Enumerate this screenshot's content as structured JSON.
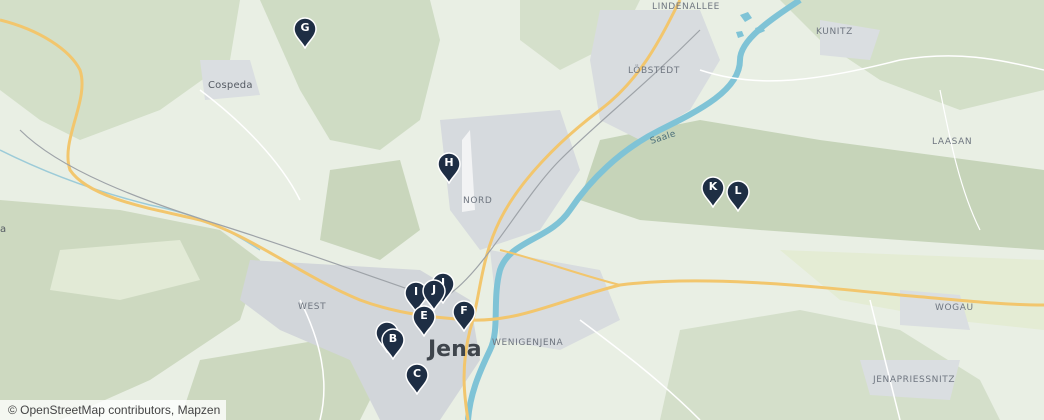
{
  "map": {
    "attribution": "© OpenStreetMap contributors, Mapzen",
    "colors": {
      "land": "#e9efe4",
      "forest": "#cfdcc4",
      "urban": "#d6dade",
      "river": "#7fc3d6",
      "road_major": "#f2c66d",
      "road_minor": "#ffffff",
      "marker": "#1e2e44",
      "marker_text": "#ffffff"
    },
    "places": {
      "lindenallee": "LINDENALLEE",
      "kunitz": "KUNITZ",
      "cospeda": "Cospeda",
      "lobstedt": "LÖBSTEDT",
      "saale": "Saale",
      "laasan": "LAASAN",
      "nord": "NORD",
      "west": "WEST",
      "wogau": "WOGAU",
      "wenigenjena": "WENIGENJENA",
      "jena": "Jena",
      "jenapriessnitz": "JENAPRIESSNITZ",
      "edge_a": "a"
    },
    "markers": [
      {
        "label": "G"
      },
      {
        "label": "H"
      },
      {
        "label": "K"
      },
      {
        "label": "L"
      },
      {
        "label": "J"
      },
      {
        "label": "I"
      },
      {
        "label": "J"
      },
      {
        "label": "F"
      },
      {
        "label": "E"
      },
      {
        "label": ""
      },
      {
        "label": "B"
      },
      {
        "label": "C"
      }
    ]
  }
}
